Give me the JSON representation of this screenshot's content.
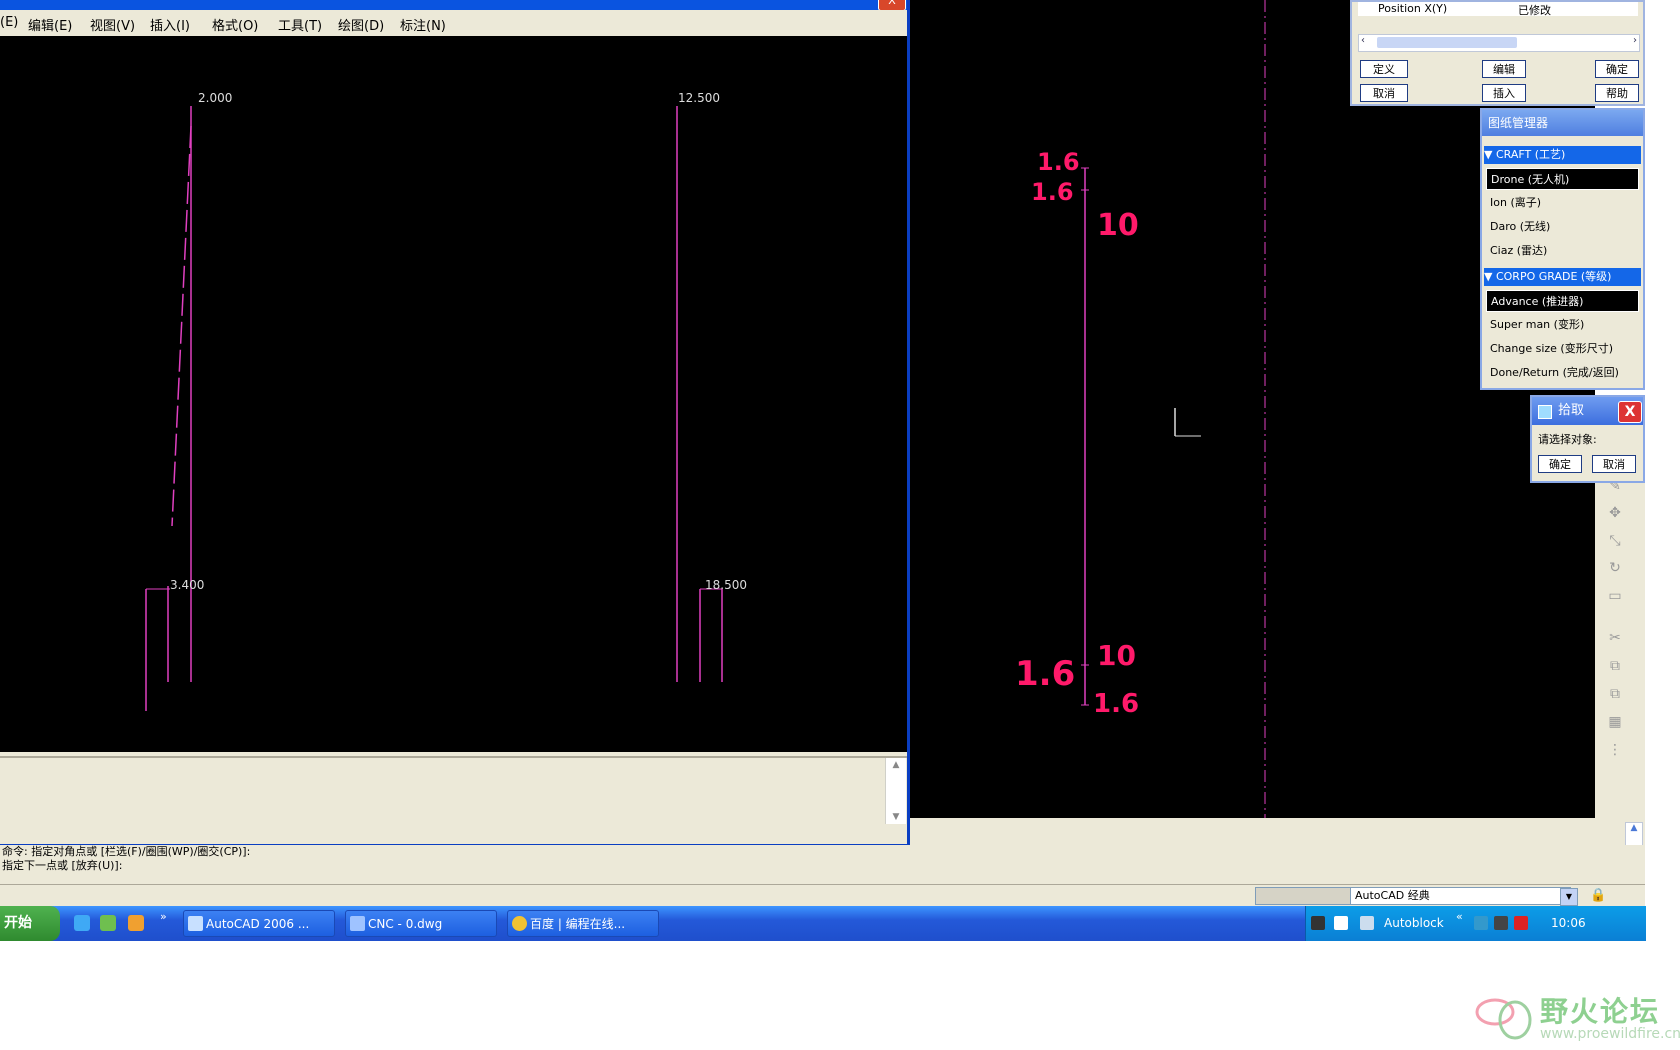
{
  "colors": {
    "cad_line": "#e040c0",
    "annotation": "#ff1a6a",
    "xp_blue": "#2459d9",
    "window_frame": "#0a3ec2"
  },
  "cad_window": {
    "menu": [
      "(E)",
      "编辑(E)",
      "视图(V)",
      "插入(I)",
      "格式(O)",
      "工具(T)",
      "绘图(D)",
      "标注(N)"
    ],
    "close_label": "X",
    "labels": {
      "top_left": "2.000",
      "top_right": "12.500",
      "bottom_left": "3.400",
      "bottom_right": "18.500"
    }
  },
  "annotations": {
    "a1": "1.6",
    "a2": "1.6",
    "a3": "10",
    "a4": "10",
    "a5": "1.6",
    "a6": "1.6"
  },
  "command_lines": [
    "命令: 指定对角点或 [栏选(F)/圈围(WP)/圈交(CP)]:",
    "指定下一点或 [放弃(U)]:"
  ],
  "status": {
    "layer_field": "AutoCAD 经典",
    "combo_value": ""
  },
  "taskbar": {
    "start_label": "开始",
    "tasks": [
      {
        "name": "autocad",
        "label": "AutoCAD 2006 ..."
      },
      {
        "name": "drawing",
        "label": "CNC - 0.dwg"
      },
      {
        "name": "chrome",
        "label": "百度 | 编程在线..."
      }
    ],
    "tray_text": "Autoblock",
    "clock": "10:06"
  },
  "props_palette": {
    "row_label": "Position X(Y)",
    "row_value": "已修改",
    "buttons": [
      "定义",
      "编辑",
      "确定",
      "取消",
      "插入",
      "帮助"
    ]
  },
  "sheet_palette": {
    "title": "图纸管理器",
    "section1": "▼ CRAFT (工艺)",
    "items1": [
      "Drone (无人机)",
      "Ion (离子)",
      "Daro (无线)",
      "Ciaz (雷达)"
    ],
    "section2": "▼ CORPO GRADE (等级)",
    "items2": [
      "Advance (推进器)",
      "Super man (变形)",
      "Change size (变形尺寸)",
      "Done/Return (完成/返回)"
    ]
  },
  "float_panel": {
    "title": "拾取",
    "row1": "请选择对象:",
    "btn1": "确定",
    "btn2": "取消",
    "close": "X"
  },
  "watermark": {
    "title": "野火论坛",
    "url": "www.proewildfire.cn"
  }
}
